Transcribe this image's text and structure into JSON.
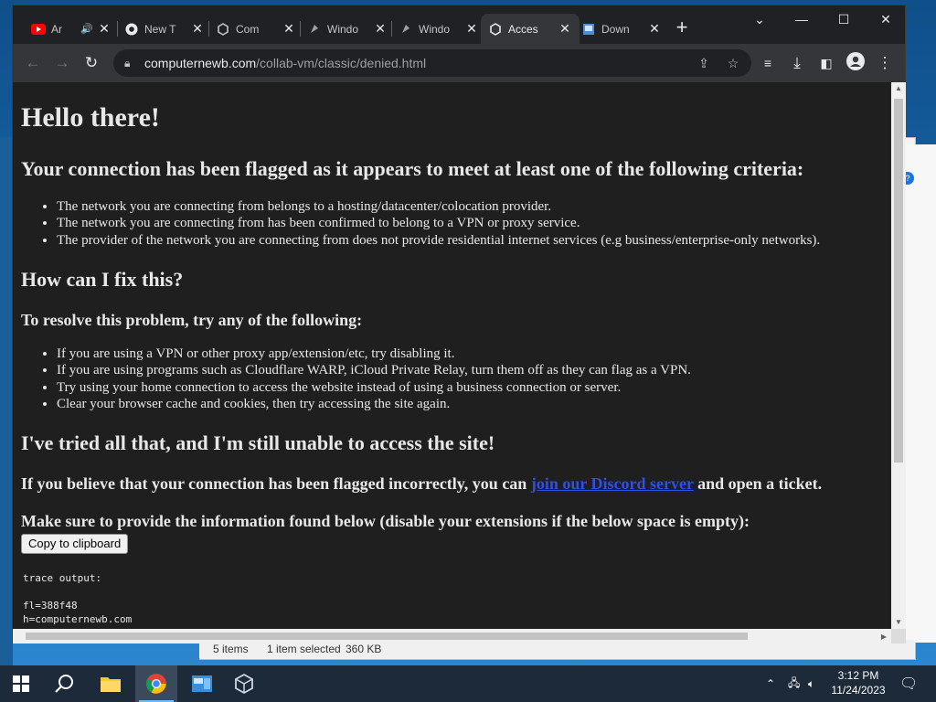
{
  "background_window": {
    "status_items": "5 items",
    "status_selected": "1 item selected",
    "status_size": "360 KB"
  },
  "tabs": [
    {
      "label": "Ar",
      "icon": "youtube-icon",
      "sound": "🔊"
    },
    {
      "label": "New T",
      "icon": "chrome-icon"
    },
    {
      "label": "Com",
      "icon": "collabvm-icon",
      "hovered": true
    },
    {
      "label": "Windo",
      "icon": "collabvm-icon"
    },
    {
      "label": "Windo",
      "icon": "collabvm-icon"
    },
    {
      "label": "Acces",
      "icon": "collabvm-icon",
      "active": true
    },
    {
      "label": "Down",
      "icon": "download-page-icon"
    }
  ],
  "address": {
    "domain": "computernewb.com",
    "path": "/collab-vm/classic/denied.html"
  },
  "page": {
    "greeting": "Hello there!",
    "criteria_heading": "Your connection has been flagged as it appears to meet at least one of the following criteria:",
    "criteria": [
      "The network you are connecting from belongs to a hosting/datacenter/colocation provider.",
      "The network you are connecting from has been confirmed to belong to a VPN or proxy service.",
      "The provider of the network you are connecting from does not provide residential internet services (e.g business/enterprise-only networks)."
    ],
    "fix_heading": "How can I fix this?",
    "resolve_heading": "To resolve this problem, try any of the following:",
    "fixes": [
      "If you are using a VPN or other proxy app/extension/etc, try disabling it.",
      "If you are using programs such as Cloudflare WARP, iCloud Private Relay, turn them off as they can flag as a VPN.",
      "Try using your home connection to access the website instead of using a business connection or server.",
      "Clear your browser cache and cookies, then try accessing the site again."
    ],
    "tried_heading": "I've tried all that, and I'm still unable to access the site!",
    "believe_prefix": "If you believe that your connection has been flagged incorrectly, you can ",
    "discord_link": "join our Discord server",
    "believe_suffix": " and open a ticket.",
    "provide_heading": "Make sure to provide the information found below (disable your extensions if the below space is empty):",
    "copy_button": "Copy to clipboard",
    "trace_label": "trace output:",
    "trace_lines": [
      "fl=388f48",
      "h=computernewb.com"
    ]
  },
  "taskbar": {
    "time": "3:12 PM",
    "date": "11/24/2023"
  },
  "colors": {
    "link": "#2d4fea",
    "page_bg": "#1f1f20",
    "chrome_bg": "#202124",
    "toolbar_bg": "#35363a"
  }
}
